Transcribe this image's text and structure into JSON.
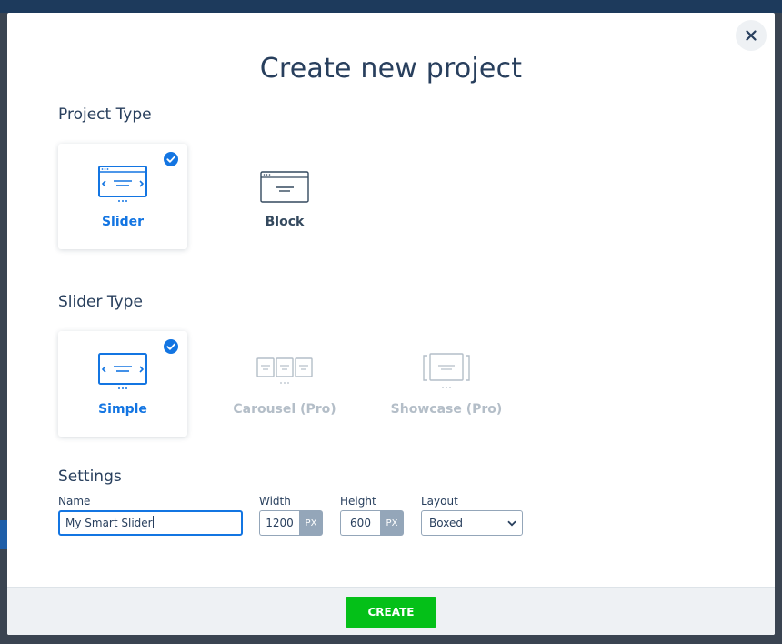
{
  "modal": {
    "title": "Create new project"
  },
  "project_type": {
    "heading": "Project Type",
    "options": [
      {
        "label": "Slider",
        "selected": true
      },
      {
        "label": "Block",
        "selected": false
      }
    ]
  },
  "slider_type": {
    "heading": "Slider Type",
    "options": [
      {
        "label": "Simple",
        "selected": true,
        "disabled": false
      },
      {
        "label": "Carousel (Pro)",
        "selected": false,
        "disabled": true
      },
      {
        "label": "Showcase (Pro)",
        "selected": false,
        "disabled": true
      }
    ]
  },
  "settings": {
    "heading": "Settings",
    "name": {
      "label": "Name",
      "value": "My Smart Slider"
    },
    "width": {
      "label": "Width",
      "value": "1200",
      "unit": "PX"
    },
    "height": {
      "label": "Height",
      "value": "600",
      "unit": "PX"
    },
    "layout": {
      "label": "Layout",
      "value": "Boxed"
    }
  },
  "footer": {
    "create_label": "CREATE"
  },
  "colors": {
    "accent": "#1375e2",
    "create_button": "#04c018",
    "text": "#283f5d",
    "disabled_text": "#b4bec8"
  },
  "icons": {
    "close": "close-icon",
    "check": "check-circle-icon",
    "slider": "slider-icon",
    "block": "block-icon",
    "simple": "simple-slider-icon",
    "carousel": "carousel-icon",
    "showcase": "showcase-icon",
    "dropdown": "chevron-down-icon"
  }
}
